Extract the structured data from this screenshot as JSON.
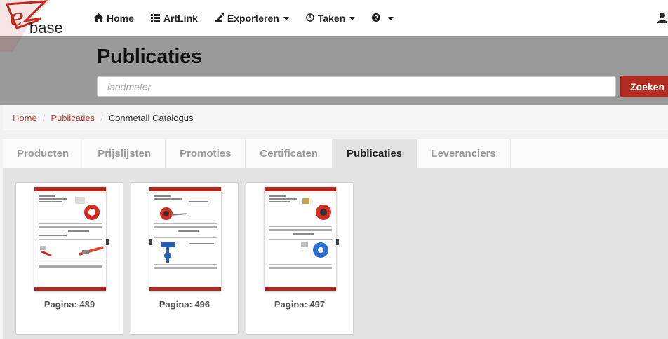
{
  "brand": {
    "logo_text": "base"
  },
  "nav": {
    "home": "Home",
    "artlink": "ArtLink",
    "exporteren": "Exporteren",
    "taken": "Taken"
  },
  "header": {
    "title": "Publicaties",
    "search_placeholder": "landmeter",
    "search_button": "Zoeken"
  },
  "breadcrumb": {
    "items": [
      "Home",
      "Publicaties"
    ],
    "current": "Conmetall Catalogus"
  },
  "tabs": [
    {
      "label": "Producten",
      "active": false
    },
    {
      "label": "Prijslijsten",
      "active": false
    },
    {
      "label": "Promoties",
      "active": false
    },
    {
      "label": "Certificaten",
      "active": false
    },
    {
      "label": "Publicaties",
      "active": true
    },
    {
      "label": "Leveranciers",
      "active": false
    }
  ],
  "publications": [
    {
      "caption": "Pagina: 489"
    },
    {
      "caption": "Pagina: 496"
    },
    {
      "caption": "Pagina: 497"
    }
  ],
  "colors": {
    "accent": "#b22c22",
    "header_bg": "#9a9a9a",
    "link": "#c0392b"
  }
}
